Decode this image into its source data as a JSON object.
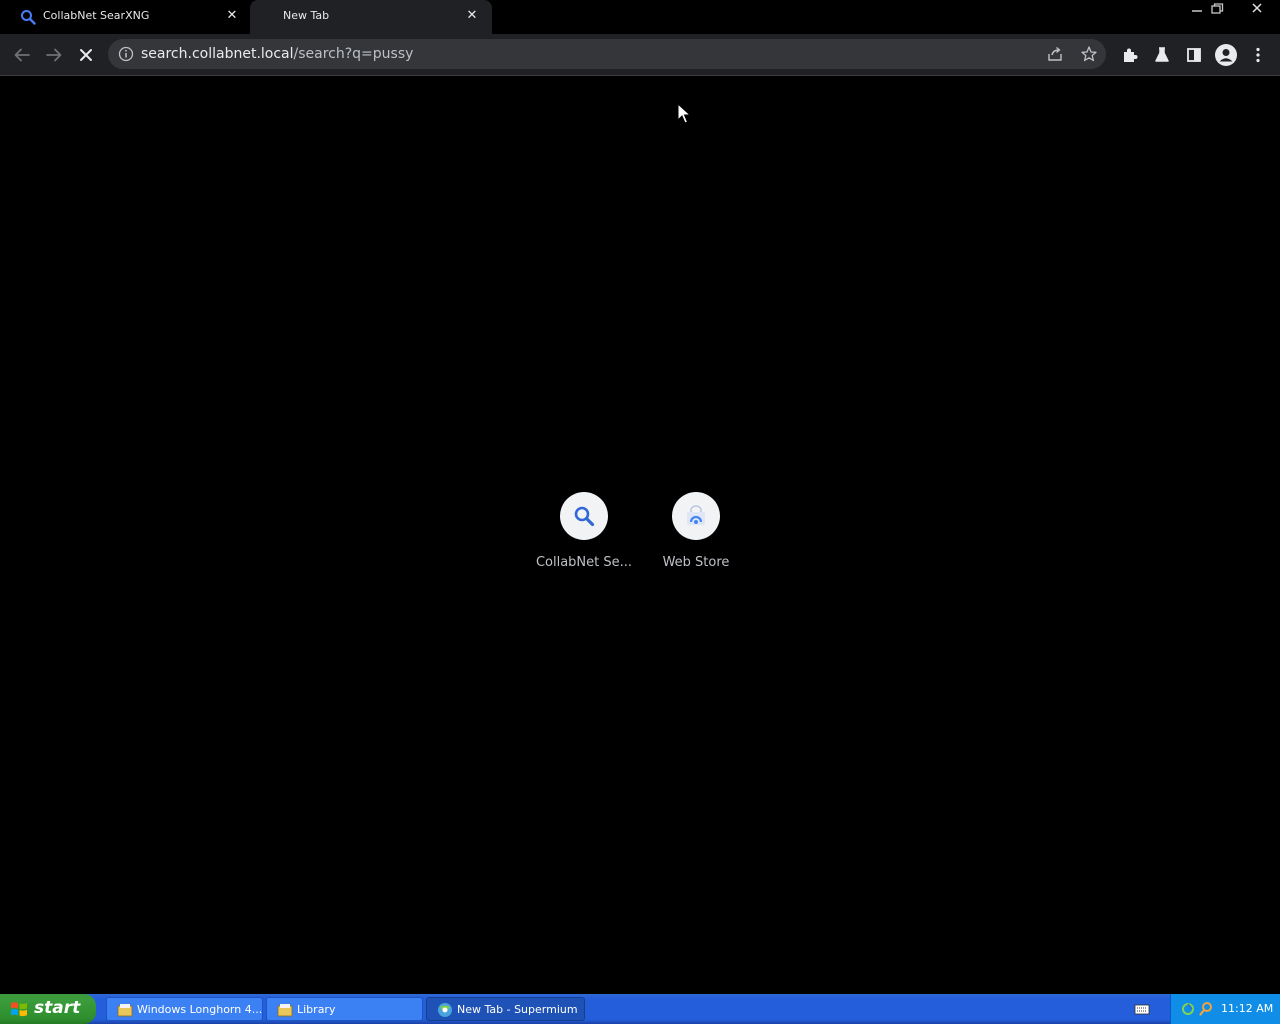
{
  "browser": {
    "tabs": [
      {
        "title": "CollabNet SearXNG",
        "favicon": "search-icon",
        "active": false
      },
      {
        "title": "New Tab",
        "favicon": "none",
        "active": true
      }
    ],
    "toolbar": {
      "url_host": "search.collabnet.local",
      "url_path": "/search?q=pussy",
      "loading": true
    },
    "shortcuts": [
      {
        "label": "CollabNet Se...",
        "icon": "search-icon",
        "accent": "#3367d6"
      },
      {
        "label": "Web Store",
        "icon": "web-store-icon",
        "accent": "#4285f4"
      }
    ]
  },
  "taskbar": {
    "start_label": "start",
    "tasks": [
      {
        "label": "Windows Longhorn 4...",
        "icon": "explorer-icon",
        "active": false
      },
      {
        "label": "Library",
        "icon": "explorer-icon",
        "active": false
      },
      {
        "label": "New Tab - Supermium",
        "icon": "browser-icon",
        "active": true
      }
    ],
    "clock": "11:12 AM"
  },
  "colors": {
    "taskbar_blue": "#245edb",
    "start_green": "#3a9c3a",
    "tray_blue": "#0f8de7",
    "browser_chrome": "#202124"
  }
}
